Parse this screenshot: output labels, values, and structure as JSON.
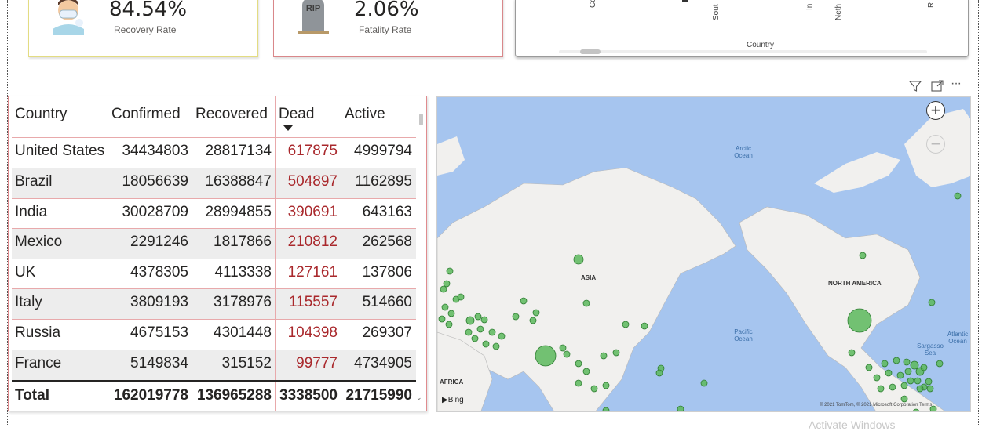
{
  "kpis": {
    "recovery": {
      "value": "84.54%",
      "label": "Recovery Rate",
      "icon": "masked-face-icon"
    },
    "fatality": {
      "value": "2.06%",
      "label": "Fatality Rate",
      "icon": "rip-tombstone-icon",
      "icon_text": "RIP"
    }
  },
  "top_chart": {
    "x_axis_title": "Country",
    "visible_tick_labels": [
      "Co",
      "Sout",
      "In",
      "Neth",
      "R"
    ]
  },
  "visual_header": {
    "icons": [
      "filter-icon",
      "focus-mode-icon",
      "more-options-icon"
    ],
    "more_label": "···"
  },
  "table": {
    "columns": [
      "Country",
      "Confirmed",
      "Recovered",
      "Dead",
      "Active"
    ],
    "sorted_column": "Dead",
    "rows": [
      [
        "United States",
        "34434803",
        "28817134",
        "617875",
        "4999794"
      ],
      [
        "Brazil",
        "18056639",
        "16388847",
        "504897",
        "1162895"
      ],
      [
        "India",
        "30028709",
        "28994855",
        "390691",
        "643163"
      ],
      [
        "Mexico",
        "2291246",
        "1817866",
        "210812",
        "262568"
      ],
      [
        "UK",
        "4378305",
        "4113338",
        "127161",
        "137806"
      ],
      [
        "Italy",
        "3809193",
        "3178976",
        "115557",
        "514660"
      ],
      [
        "Russia",
        "4675153",
        "4301448",
        "104398",
        "269307"
      ],
      [
        "France",
        "5149834",
        "315152",
        "99777",
        "4734905"
      ]
    ],
    "total": [
      "Total",
      "162019778",
      "136965288",
      "3338500",
      "21715990"
    ]
  },
  "map": {
    "continent_labels": [
      "ASIA",
      "NORTH AMERICA",
      "AFRICA"
    ],
    "ocean_labels": [
      "Arctic Ocean",
      "Pacific Ocean",
      "Atlantic Ocean",
      "Sargasso Sea"
    ],
    "zoom_in": "+",
    "zoom_out": "−",
    "attribution": "Bing",
    "copyright": "© 2021 TomTom, © 2021 Microsoft Corporation  Terms"
  },
  "colors": {
    "dead_text": "#a9282c",
    "table_border": "#e08b8e",
    "recovery_card_border": "#e3dc82",
    "map_water": "#a6c5ef",
    "map_land": "#f1f0ee",
    "bubble_fill": "#5cb85c",
    "bubble_stroke": "#2f7d32"
  },
  "watermark": "Activate Windows"
}
